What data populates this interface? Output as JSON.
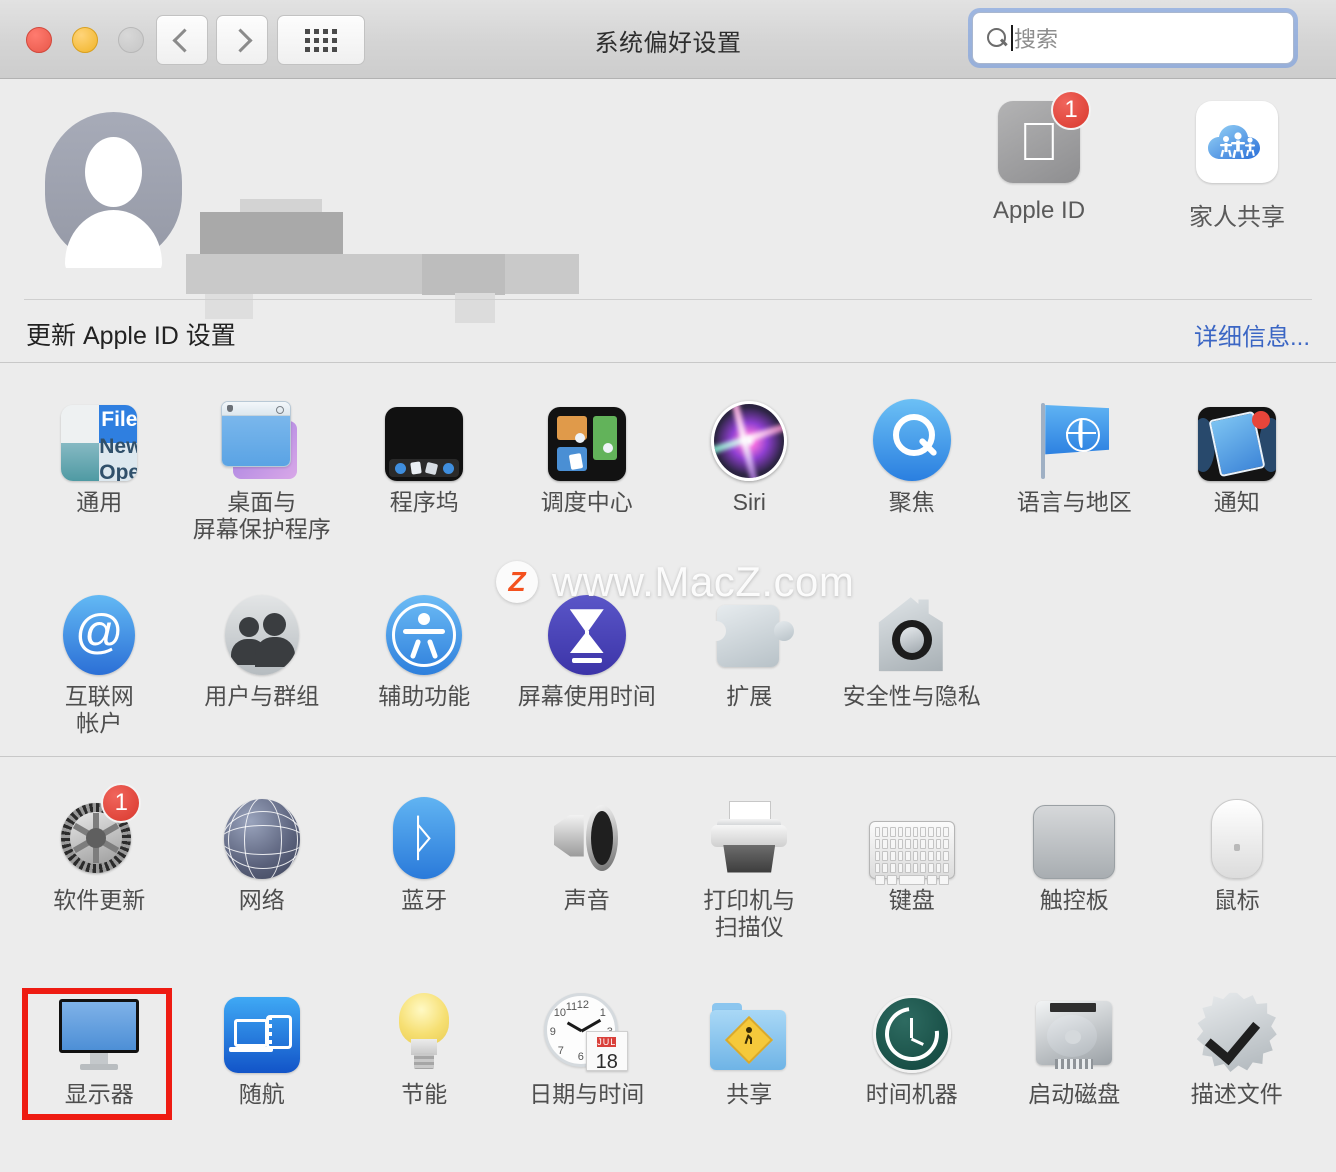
{
  "window": {
    "title": "系统偏好设置",
    "traffic_lights": [
      "close",
      "minimize",
      "zoom"
    ],
    "nav": {
      "back": "back-chevron",
      "forward": "forward-chevron",
      "grid": "show-all-grid"
    },
    "search": {
      "placeholder": "搜索",
      "value": "",
      "icon": "search-icon",
      "focused": true
    }
  },
  "apple_id": {
    "avatar": "user-avatar-placeholder",
    "name_redacted": true,
    "tiles": [
      {
        "label": "Apple ID",
        "icon": "apple-logo-icon",
        "badge": "1"
      },
      {
        "label": "家人共享",
        "icon": "family-sharing-cloud-icon",
        "badge": ""
      }
    ],
    "update_text": "更新 Apple ID 设置",
    "detail_link": "详细信息..."
  },
  "groups": [
    {
      "name": "personal",
      "rows": [
        [
          {
            "label": "通用",
            "icon": "general-icon"
          },
          {
            "label": "桌面与\n屏幕保护程序",
            "icon": "desktop-screensaver-icon"
          },
          {
            "label": "程序坞",
            "icon": "dock-icon"
          },
          {
            "label": "调度中心",
            "icon": "mission-control-icon"
          },
          {
            "label": "Siri",
            "icon": "siri-icon"
          },
          {
            "label": "聚焦",
            "icon": "spotlight-icon"
          },
          {
            "label": "语言与地区",
            "icon": "language-region-icon"
          },
          {
            "label": "通知",
            "icon": "notifications-icon"
          }
        ],
        [
          {
            "label": "互联网\n帐户",
            "icon": "internet-accounts-icon"
          },
          {
            "label": "用户与群组",
            "icon": "users-groups-icon"
          },
          {
            "label": "辅助功能",
            "icon": "accessibility-icon"
          },
          {
            "label": "屏幕使用时间",
            "icon": "screen-time-icon"
          },
          {
            "label": "扩展",
            "icon": "extensions-puzzle-icon"
          },
          {
            "label": "安全性与隐私",
            "icon": "security-privacy-icon"
          }
        ]
      ]
    },
    {
      "name": "hardware",
      "rows": [
        [
          {
            "label": "软件更新",
            "icon": "software-update-icon",
            "badge": "1"
          },
          {
            "label": "网络",
            "icon": "network-globe-icon"
          },
          {
            "label": "蓝牙",
            "icon": "bluetooth-icon"
          },
          {
            "label": "声音",
            "icon": "sound-speaker-icon"
          },
          {
            "label": "打印机与\n扫描仪",
            "icon": "printers-scanners-icon"
          },
          {
            "label": "键盘",
            "icon": "keyboard-icon"
          },
          {
            "label": "触控板",
            "icon": "trackpad-icon"
          },
          {
            "label": "鼠标",
            "icon": "mouse-icon"
          }
        ],
        [
          {
            "label": "显示器",
            "icon": "displays-icon",
            "highlighted": true
          },
          {
            "label": "随航",
            "icon": "sidecar-icon"
          },
          {
            "label": "节能",
            "icon": "energy-saver-icon"
          },
          {
            "label": "日期与时间",
            "icon": "date-time-icon"
          },
          {
            "label": "共享",
            "icon": "sharing-icon"
          },
          {
            "label": "时间机器",
            "icon": "time-machine-icon"
          },
          {
            "label": "启动磁盘",
            "icon": "startup-disk-icon"
          },
          {
            "label": "描述文件",
            "icon": "profiles-icon"
          }
        ]
      ]
    }
  ],
  "date_time_icon": {
    "month": "JUL",
    "day": "18"
  },
  "general_icon_text": {
    "line1": "File",
    "line2": "New",
    "line3": "Ope"
  },
  "watermark": {
    "logo": "Z",
    "text": "www.MacZ.com"
  },
  "colors": {
    "accent_blue": "#3b66c4",
    "badge_red": "#d9382d",
    "highlight_red": "#ee1b12",
    "window_bg": "#ececec"
  }
}
